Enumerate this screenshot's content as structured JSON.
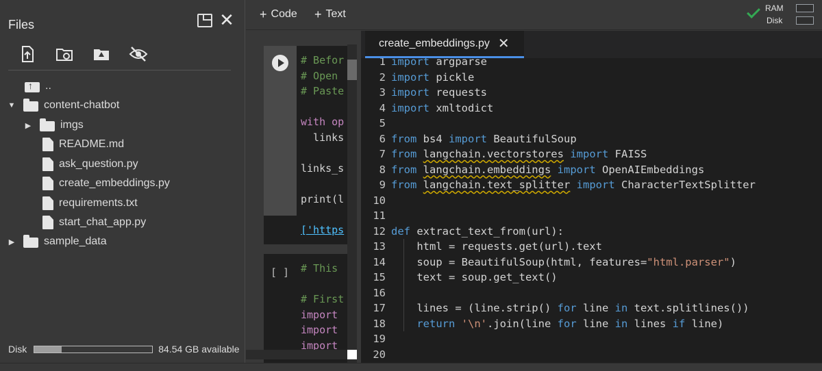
{
  "sidebar": {
    "title": "Files",
    "toolbar": [
      {
        "name": "upload-file-icon"
      },
      {
        "name": "refresh-folder-icon"
      },
      {
        "name": "mount-drive-icon"
      },
      {
        "name": "hide-files-icon"
      }
    ],
    "tree": [
      {
        "label": "..",
        "type": "up",
        "depth": 1
      },
      {
        "label": "content-chatbot",
        "type": "folder",
        "expanded": true,
        "depth": 0
      },
      {
        "label": "imgs",
        "type": "folder",
        "expanded": false,
        "depth": 1
      },
      {
        "label": "README.md",
        "type": "file",
        "depth": 1
      },
      {
        "label": "ask_question.py",
        "type": "file",
        "depth": 1
      },
      {
        "label": "create_embeddings.py",
        "type": "file",
        "depth": 1
      },
      {
        "label": "requirements.txt",
        "type": "file",
        "depth": 1
      },
      {
        "label": "start_chat_app.py",
        "type": "file",
        "depth": 1
      },
      {
        "label": "sample_data",
        "type": "folder",
        "expanded": false,
        "depth": 0
      }
    ],
    "disk": {
      "label": "Disk",
      "available": "84.54 GB available",
      "used_fraction": 0.23
    }
  },
  "topbar": {
    "code_button": "Code",
    "text_button": "Text",
    "ram_label": "RAM",
    "disk_label": "Disk",
    "ram_fraction": 0.0,
    "disk_fraction": 0.0,
    "status_color": "#34a853"
  },
  "cells": [
    {
      "lines": [
        "# Befor",
        "# Open ",
        "# Paste",
        "",
        "with op",
        "  links",
        "",
        "links_s",
        "",
        "print(l"
      ],
      "output": "['https"
    },
    {
      "exec": "[ ]",
      "lines": [
        "# This ",
        "",
        "# First",
        "import",
        "import",
        "import"
      ]
    }
  ],
  "editor": {
    "tab_label": "create_embeddings.py",
    "code": [
      {
        "n": "1",
        "text": "import argparse"
      },
      {
        "n": "2",
        "text": "import pickle"
      },
      {
        "n": "3",
        "text": "import requests"
      },
      {
        "n": "4",
        "text": "import xmltodict"
      },
      {
        "n": "5",
        "text": ""
      },
      {
        "n": "6",
        "text": "from bs4 import BeautifulSoup"
      },
      {
        "n": "7",
        "text": "from langchain.vectorstores import FAISS"
      },
      {
        "n": "8",
        "text": "from langchain.embeddings import OpenAIEmbeddings"
      },
      {
        "n": "9",
        "text": "from langchain.text_splitter import CharacterTextSplitter"
      },
      {
        "n": "10",
        "text": ""
      },
      {
        "n": "11",
        "text": ""
      },
      {
        "n": "12",
        "text": "def extract_text_from(url):"
      },
      {
        "n": "13",
        "text": "    html = requests.get(url).text"
      },
      {
        "n": "14",
        "text": "    soup = BeautifulSoup(html, features=\"html.parser\")"
      },
      {
        "n": "15",
        "text": "    text = soup.get_text()"
      },
      {
        "n": "16",
        "text": ""
      },
      {
        "n": "17",
        "text": "    lines = (line.strip() for line in text.splitlines())"
      },
      {
        "n": "18",
        "text": "    return '\\n'.join(line for line in lines if line)"
      },
      {
        "n": "19",
        "text": ""
      },
      {
        "n": "20",
        "text": ""
      }
    ]
  }
}
